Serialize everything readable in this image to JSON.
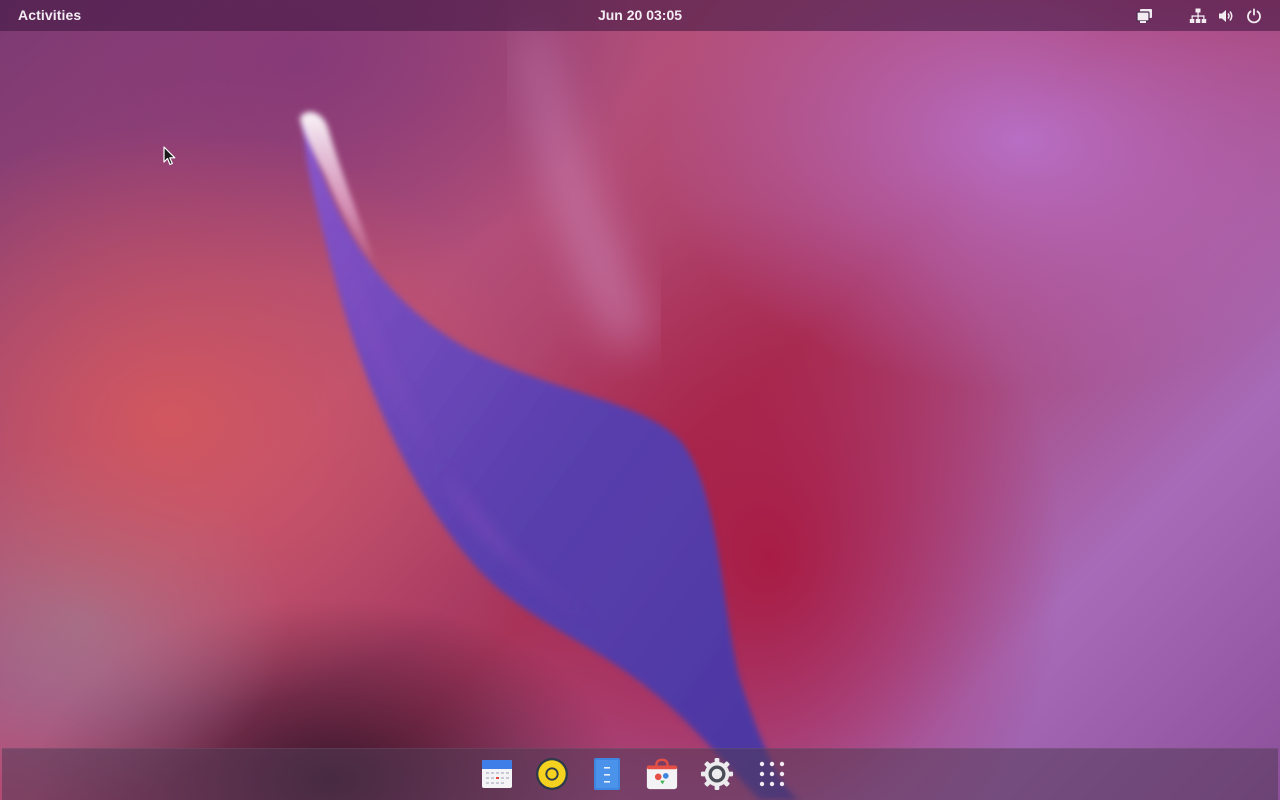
{
  "top_bar": {
    "activities_label": "Activities",
    "clock_text": "Jun 20  03:05"
  },
  "tray_icons": [
    {
      "icon": "screen-share-icon"
    },
    {
      "icon": "network-icon"
    },
    {
      "icon": "volume-icon"
    },
    {
      "icon": "power-icon"
    }
  ],
  "dock": {
    "apps": [
      {
        "icon": "calendar-icon"
      },
      {
        "icon": "rhythmbox-icon"
      },
      {
        "icon": "text-editor-icon"
      },
      {
        "icon": "software-center-icon"
      },
      {
        "icon": "settings-gear-icon"
      },
      {
        "icon": "show-apps-grid-icon"
      }
    ]
  },
  "colors": {
    "top_bar_text": "#f2ecf2",
    "wallpaper_purple": "#6b4bb8",
    "wallpaper_pink": "#b44f79",
    "wallpaper_red": "#a8365c"
  }
}
